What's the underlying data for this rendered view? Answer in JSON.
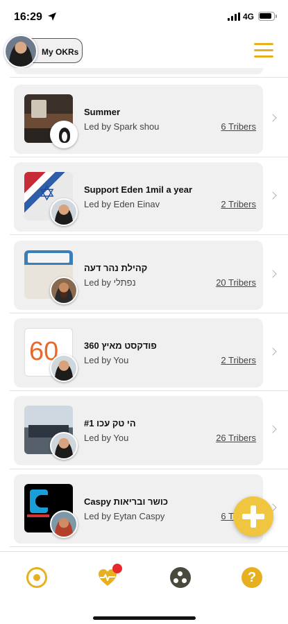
{
  "status_bar": {
    "time": "16:29",
    "network": "4G",
    "icons": [
      "location-arrow-icon",
      "signal-icon",
      "battery-icon"
    ]
  },
  "header": {
    "okr_button_label": "My OKRs",
    "menu_icon": "hamburger-menu-icon"
  },
  "tribes": [
    {
      "title": "Summer",
      "leader": "Led by Spark shou",
      "tribers": "6 Tribers"
    },
    {
      "title": "Support Eden 1mil a year",
      "leader": "Led by Eden Einav",
      "tribers": "2 Tribers"
    },
    {
      "title": "קהילת נהר דעה",
      "leader": "Led by נפתלי",
      "tribers": "20 Tribers"
    },
    {
      "title": "פודקסט מאיץ 360",
      "leader": "Led by  You",
      "tribers": "2 Tribers",
      "thumb_text": "60"
    },
    {
      "title": "הי טק עכו #1",
      "leader": "Led by  You",
      "tribers": "26 Tribers"
    },
    {
      "title": "Caspy כושר ובריאות",
      "leader": "Led by Eytan Caspy",
      "tribers": "6 Tribers"
    }
  ],
  "fab": {
    "icon": "plus-icon",
    "color": "#f0c53f"
  },
  "bottom_nav": {
    "items": [
      "target-icon",
      "heart-pulse-icon",
      "tribes-dots-icon",
      "help-question-icon"
    ],
    "help_glyph": "?",
    "accent_color": "#e6b021",
    "notification_color": "#e5282a"
  }
}
